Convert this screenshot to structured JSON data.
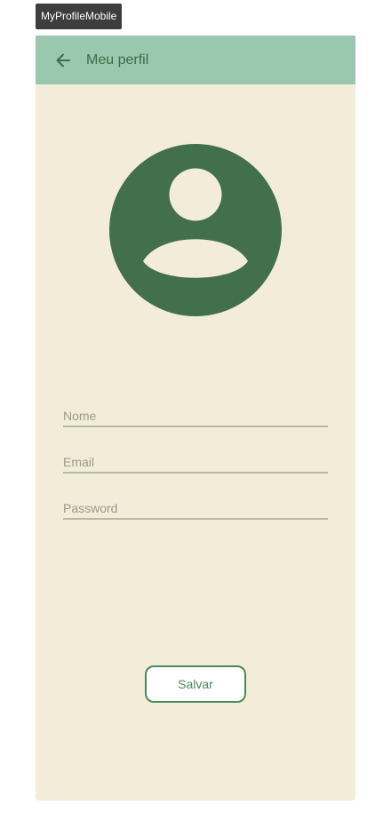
{
  "frame": {
    "label": "MyProfileMobile"
  },
  "app_bar": {
    "back_icon": "arrow-left-icon",
    "title": "Meu perfil"
  },
  "avatar": {
    "icon": "account-circle-icon",
    "color": "#426f4c"
  },
  "form": {
    "name": {
      "placeholder": "Nome",
      "value": ""
    },
    "email": {
      "placeholder": "Email",
      "value": ""
    },
    "password": {
      "placeholder": "Password",
      "value": ""
    }
  },
  "actions": {
    "save_label": "Salvar"
  },
  "colors": {
    "app_bar": "#9ac8ae",
    "background": "#f3ecd8",
    "accent": "#4a8a5a",
    "text_muted": "#9a9a8c"
  }
}
